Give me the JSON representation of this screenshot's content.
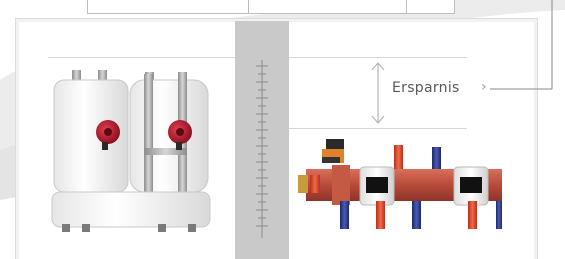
{
  "savings_label": "Ersparnis",
  "brace_glyph": "›",
  "colors": {
    "panel_bg": "#f2f2f2",
    "ruler_col": "#c9c9c9",
    "pump_red": "#b01c2e",
    "manifold": "#c0503c",
    "pipe_blue": "#2a3a8c",
    "pipe_red": "#d9462b"
  }
}
